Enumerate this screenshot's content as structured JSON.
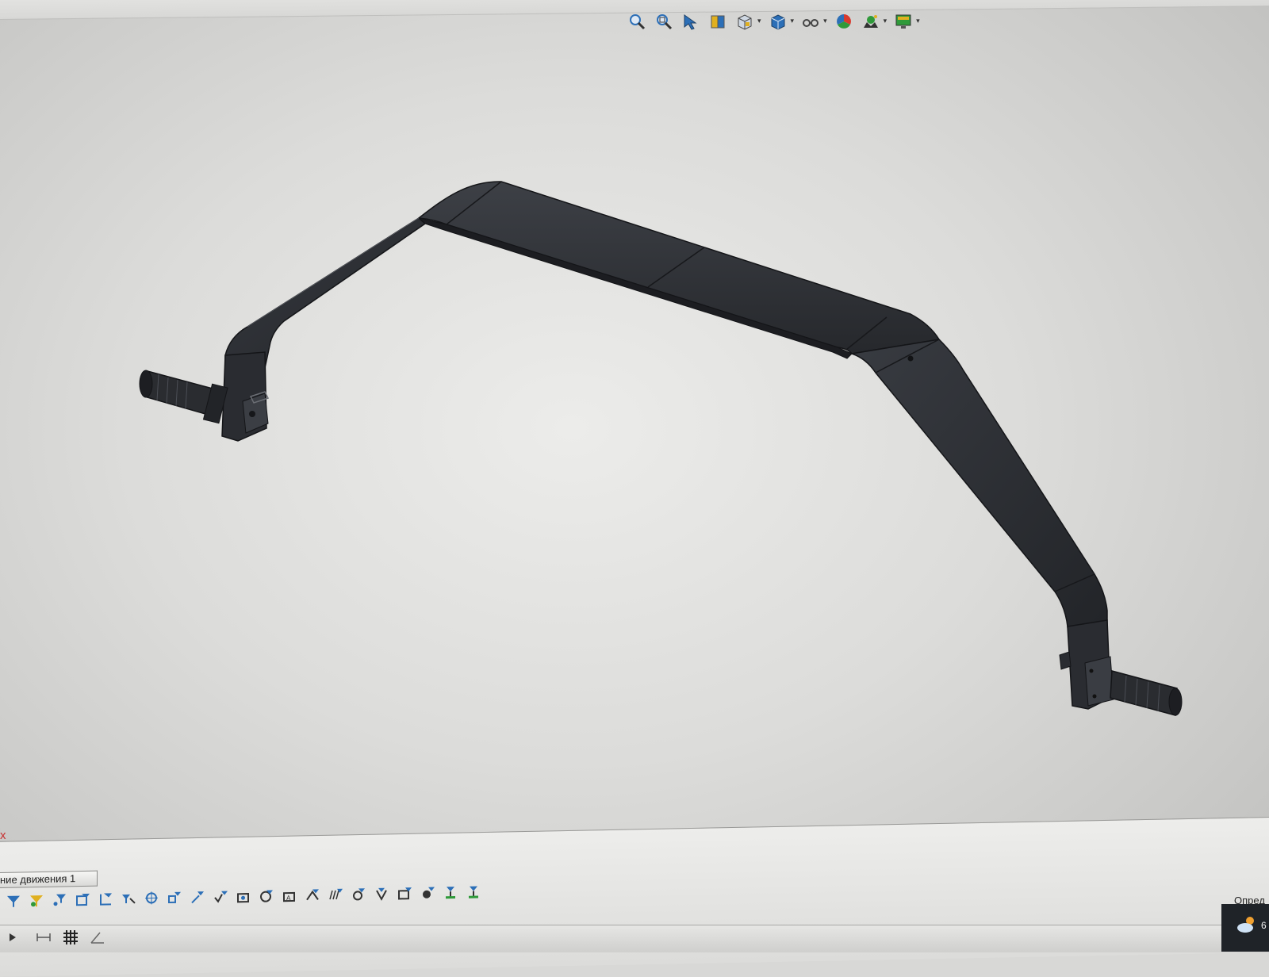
{
  "heads_up_toolbar": {
    "buttons": [
      {
        "name": "zoom-to-fit",
        "icon": "magnifier-icon"
      },
      {
        "name": "zoom-to-area",
        "icon": "magnifier-area-icon"
      },
      {
        "name": "previous-view",
        "icon": "arrow-view-icon"
      },
      {
        "name": "section-view",
        "icon": "section-view-icon"
      },
      {
        "name": "view-orientation",
        "icon": "orientation-cube-icon",
        "dropdown": true
      },
      {
        "name": "display-style",
        "icon": "shaded-cube-icon",
        "dropdown": true
      },
      {
        "name": "hide-show-items",
        "icon": "glasses-icon",
        "dropdown": true
      },
      {
        "name": "edit-appearance",
        "icon": "color-ball-icon"
      },
      {
        "name": "apply-scene",
        "icon": "scene-icon",
        "dropdown": true
      },
      {
        "name": "view-settings",
        "icon": "monitor-icon",
        "dropdown": true
      }
    ],
    "dropdown_glyph": "▾"
  },
  "viewport": {
    "axis_label": "x"
  },
  "motion_tab": {
    "label": "ние движения 1"
  },
  "status_text": "Опред",
  "taskbar": {
    "clock_fragment": "6"
  },
  "colors": {
    "part_body": "#2f3136",
    "part_edge": "#141518",
    "part_highlight": "#4a4d54",
    "icon_blue": "#2c6fb7",
    "icon_green": "#2f9a3a",
    "icon_yellow": "#e0b020"
  }
}
